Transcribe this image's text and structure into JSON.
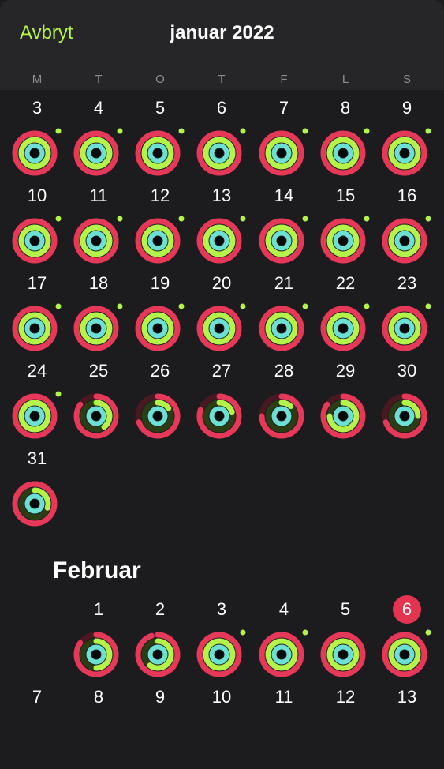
{
  "header": {
    "cancel_label": "Avbryt",
    "title": "januar 2022"
  },
  "weekdays": [
    "M",
    "T",
    "O",
    "T",
    "F",
    "L",
    "S"
  ],
  "colors": {
    "move": "#e63859",
    "move_track": "#4a1820",
    "exercise": "#b3f34a",
    "exercise_track": "#2b3d14",
    "stand": "#6de0d6",
    "stand_track": "#173a38",
    "center": "#0a0a0a",
    "goal_dot": "#b3f34a",
    "accent": "#b3f34a",
    "today_circle": "#e4344f"
  },
  "january": {
    "days": [
      {
        "day": "3",
        "move": 1,
        "exercise": 1,
        "stand": 1,
        "dot": true
      },
      {
        "day": "4",
        "move": 1,
        "exercise": 1,
        "stand": 1,
        "dot": true
      },
      {
        "day": "5",
        "move": 1,
        "exercise": 1,
        "stand": 1,
        "dot": true
      },
      {
        "day": "6",
        "move": 1,
        "exercise": 1,
        "stand": 1,
        "dot": true
      },
      {
        "day": "7",
        "move": 1,
        "exercise": 1,
        "stand": 1,
        "dot": true
      },
      {
        "day": "8",
        "move": 1,
        "exercise": 1,
        "stand": 1,
        "dot": true
      },
      {
        "day": "9",
        "move": 1,
        "exercise": 1,
        "stand": 1,
        "dot": true
      },
      {
        "day": "10",
        "move": 1,
        "exercise": 1,
        "stand": 1,
        "dot": true
      },
      {
        "day": "11",
        "move": 1,
        "exercise": 1,
        "stand": 1,
        "dot": true
      },
      {
        "day": "12",
        "move": 1,
        "exercise": 1,
        "stand": 1,
        "dot": true
      },
      {
        "day": "13",
        "move": 1,
        "exercise": 1,
        "stand": 1,
        "dot": true
      },
      {
        "day": "14",
        "move": 1,
        "exercise": 1,
        "stand": 1,
        "dot": true
      },
      {
        "day": "15",
        "move": 1,
        "exercise": 1,
        "stand": 1,
        "dot": true
      },
      {
        "day": "16",
        "move": 1,
        "exercise": 1,
        "stand": 1,
        "dot": true
      },
      {
        "day": "17",
        "move": 1,
        "exercise": 1,
        "stand": 1,
        "dot": true
      },
      {
        "day": "18",
        "move": 1,
        "exercise": 1,
        "stand": 1,
        "dot": true
      },
      {
        "day": "19",
        "move": 1,
        "exercise": 1,
        "stand": 1,
        "dot": true
      },
      {
        "day": "20",
        "move": 1,
        "exercise": 1,
        "stand": 1,
        "dot": true
      },
      {
        "day": "21",
        "move": 1,
        "exercise": 1,
        "stand": 1,
        "dot": true
      },
      {
        "day": "22",
        "move": 1,
        "exercise": 1,
        "stand": 1,
        "dot": true
      },
      {
        "day": "23",
        "move": 1,
        "exercise": 1,
        "stand": 1,
        "dot": true
      },
      {
        "day": "24",
        "move": 1,
        "exercise": 1,
        "stand": 1,
        "dot": true
      },
      {
        "day": "25",
        "move": 0.85,
        "exercise": 0.4,
        "stand": 1,
        "dot": false
      },
      {
        "day": "26",
        "move": 0.7,
        "exercise": 0.15,
        "stand": 1,
        "dot": false
      },
      {
        "day": "27",
        "move": 0.8,
        "exercise": 0.2,
        "stand": 1,
        "dot": false
      },
      {
        "day": "28",
        "move": 0.75,
        "exercise": 0.12,
        "stand": 1,
        "dot": false
      },
      {
        "day": "29",
        "move": 0.85,
        "exercise": 0.75,
        "stand": 1,
        "dot": false
      },
      {
        "day": "30",
        "move": 0.7,
        "exercise": 0.25,
        "stand": 1,
        "dot": false
      },
      {
        "day": "31",
        "move": 1,
        "exercise": 0.3,
        "stand": 1,
        "dot": false
      }
    ]
  },
  "february": {
    "title": "Februar",
    "days": [
      {
        "day": "1",
        "move": 0.85,
        "exercise": 0.5,
        "stand": 1,
        "dot": false
      },
      {
        "day": "2",
        "move": 0.95,
        "exercise": 0.6,
        "stand": 1,
        "dot": false
      },
      {
        "day": "3",
        "move": 1,
        "exercise": 1,
        "stand": 1,
        "dot": true
      },
      {
        "day": "4",
        "move": 1,
        "exercise": 1,
        "stand": 1,
        "dot": true
      },
      {
        "day": "5",
        "move": 1,
        "exercise": 1,
        "stand": 1,
        "dot": false
      },
      {
        "day": "6",
        "move": 1,
        "exercise": 1,
        "stand": 1,
        "dot": true,
        "today": true
      }
    ],
    "next_week": [
      "7",
      "8",
      "9",
      "10",
      "11",
      "12",
      "13"
    ]
  }
}
